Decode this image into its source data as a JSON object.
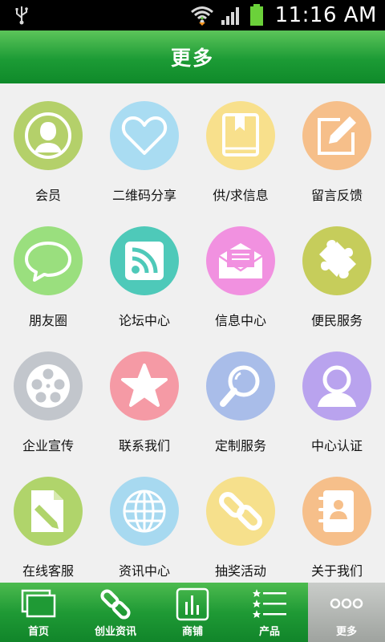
{
  "status_bar": {
    "time": "11:16 AM"
  },
  "header": {
    "title": "更多"
  },
  "grid_items": [
    {
      "label": "会员",
      "icon": "user-icon",
      "color": "#b4d06a"
    },
    {
      "label": "二维码分享",
      "icon": "heart-icon",
      "color": "#a9dcf2"
    },
    {
      "label": "供/求信息",
      "icon": "book-icon",
      "color": "#f8e08c"
    },
    {
      "label": "留言反馈",
      "icon": "edit-icon",
      "color": "#f6bf8a"
    },
    {
      "label": "朋友圈",
      "icon": "chat-bubble-icon",
      "color": "#9adf7e"
    },
    {
      "label": "论坛中心",
      "icon": "rss-icon",
      "color": "#4ec9b9"
    },
    {
      "label": "信息中心",
      "icon": "mail-icon",
      "color": "#f191e0"
    },
    {
      "label": "便民服务",
      "icon": "puzzle-icon",
      "color": "#c6cd5b"
    },
    {
      "label": "企业宣传",
      "icon": "film-reel-icon",
      "color": "#c2c6cc"
    },
    {
      "label": "联系我们",
      "icon": "star-icon",
      "color": "#f59aa5"
    },
    {
      "label": "定制服务",
      "icon": "magnifier-icon",
      "color": "#a9bde9"
    },
    {
      "label": "中心认证",
      "icon": "person-icon",
      "color": "#b9a3ee"
    },
    {
      "label": "在线客服",
      "icon": "document-pen-icon",
      "color": "#b0d46b"
    },
    {
      "label": "资讯中心",
      "icon": "globe-icon",
      "color": "#a7d9f0"
    },
    {
      "label": "抽奖活动",
      "icon": "link-icon",
      "color": "#f6e08c"
    },
    {
      "label": "关于我们",
      "icon": "contact-book-icon",
      "color": "#f6bf8a"
    }
  ],
  "bottom_nav": [
    {
      "label": "首页",
      "icon": "windows-icon"
    },
    {
      "label": "创业资讯",
      "icon": "chain-icon"
    },
    {
      "label": "商铺",
      "icon": "chart-icon"
    },
    {
      "label": "产品",
      "icon": "star-list-icon"
    },
    {
      "label": "更多",
      "icon": "more-dots-icon",
      "active": true
    }
  ]
}
